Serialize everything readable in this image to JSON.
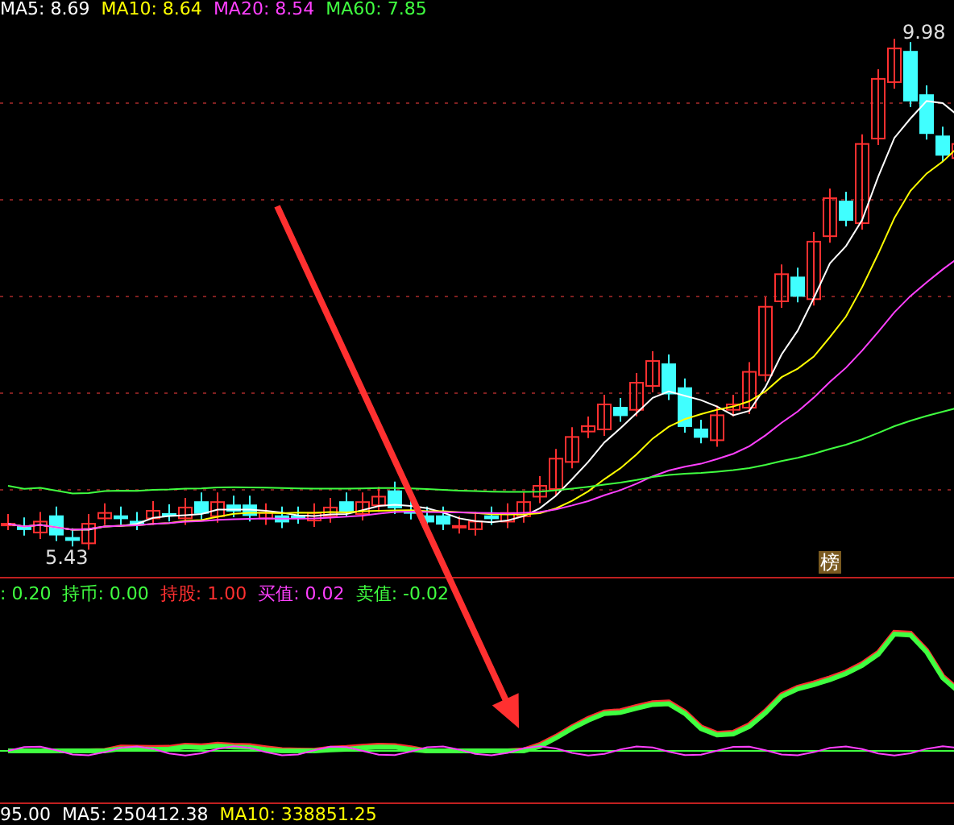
{
  "price_panel": {
    "legend": [
      {
        "label": "MA5: 8.69",
        "color": "#ffffff"
      },
      {
        "label": "MA10: 8.64",
        "color": "#ffff00"
      },
      {
        "label": "MA20: 8.54",
        "color": "#ff40ff"
      },
      {
        "label": "MA60: 7.85",
        "color": "#40ff40"
      }
    ],
    "high_label": "9.98",
    "low_label": "5.43",
    "badge": "榜"
  },
  "indicator_panel": {
    "legend": [
      {
        "label": ": 0.20",
        "color": "#40ff40"
      },
      {
        "label": "持币: 0.00",
        "color": "#40ff40"
      },
      {
        "label": "持股: 1.00",
        "color": "#ff3030"
      },
      {
        "label": "买值: 0.02",
        "color": "#ff40ff"
      },
      {
        "label": "卖值: -0.02",
        "color": "#40ff40"
      }
    ]
  },
  "volume_panel": {
    "legend": [
      {
        "label": "95.00",
        "color": "#ffffff"
      },
      {
        "label": "MA5: 250412.38",
        "color": "#ffffff"
      },
      {
        "label": "MA10: 338851.25",
        "color": "#ffff00"
      }
    ]
  }
}
